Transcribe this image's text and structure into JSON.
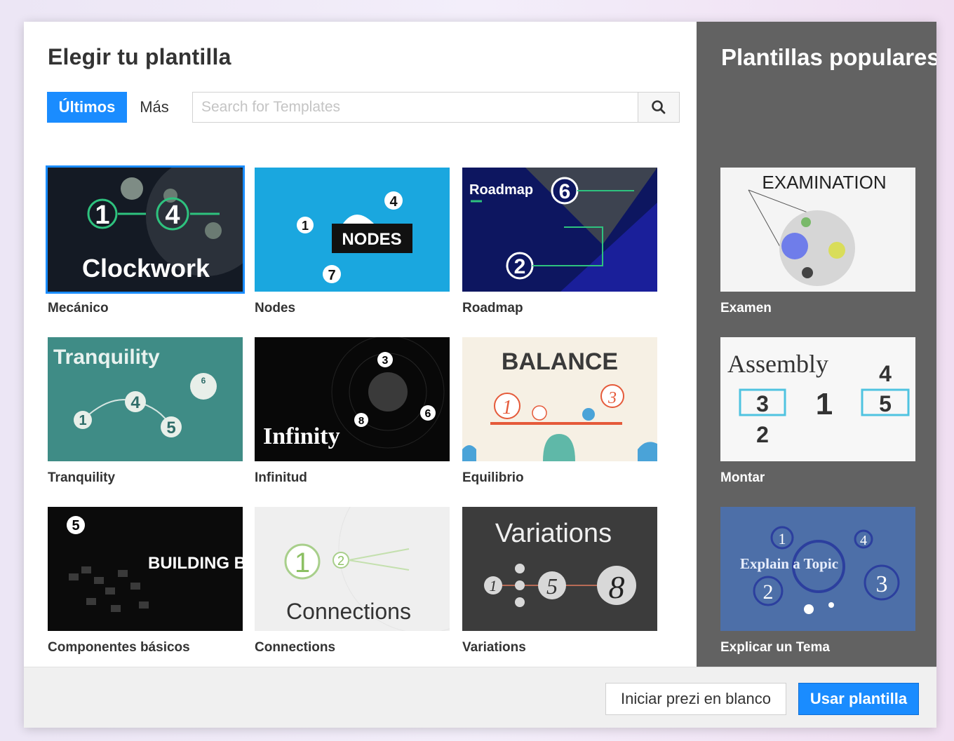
{
  "dialog": {
    "title": "Elegir tu plantilla",
    "tabs": [
      {
        "label": "Últimos",
        "active": true
      },
      {
        "label": "Más",
        "active": false
      }
    ],
    "search": {
      "placeholder": "Search for Templates",
      "value": "",
      "icon": "search-icon"
    }
  },
  "templates": [
    {
      "name": "Mecánico",
      "thumb_text": "Clockwork",
      "selected": true
    },
    {
      "name": "Nodes",
      "thumb_text": "NODES"
    },
    {
      "name": "Roadmap",
      "thumb_text": "Roadmap"
    },
    {
      "name": "Tranquility",
      "thumb_text": "Tranquility"
    },
    {
      "name": "Infinitud",
      "thumb_text": "Infinity"
    },
    {
      "name": "Equilibrio",
      "thumb_text": "BALANCE"
    },
    {
      "name": "Componentes básicos",
      "thumb_text": "BUILDING BLOCKS"
    },
    {
      "name": "Connections",
      "thumb_text": "Connections"
    },
    {
      "name": "Variations",
      "thumb_text": "Variations"
    }
  ],
  "popular": {
    "title": "Plantillas populares",
    "items": [
      {
        "name": "Examen",
        "thumb_text": "EXAMINATION"
      },
      {
        "name": "Montar",
        "thumb_text": "Assembly"
      },
      {
        "name": "Explicar un Tema",
        "thumb_text": "Explain a Topic"
      }
    ]
  },
  "footer": {
    "blank_label": "Iniciar prezi en blanco",
    "use_label": "Usar plantilla"
  },
  "colors": {
    "accent": "#1a8cff",
    "sidebar": "#626262"
  }
}
